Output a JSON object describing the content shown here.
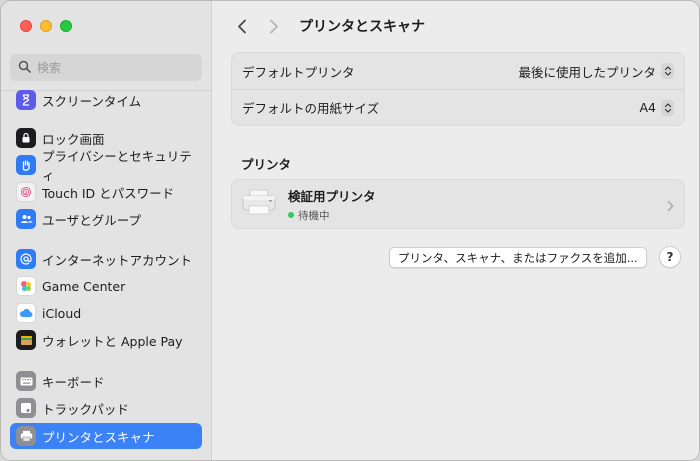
{
  "sidebar": {
    "search_placeholder": "検索",
    "items": [
      {
        "label": "スクリーンタイム",
        "icon": "hourglass-icon",
        "color": "#5e5ce6"
      },
      {
        "label": "ロック画面",
        "icon": "lock-screen-icon",
        "color": "#1c1c1e"
      },
      {
        "label": "プライバシーとセキュリティ",
        "icon": "hand-icon",
        "color": "#2f7bf5"
      },
      {
        "label": "Touch ID とパスワード",
        "icon": "fingerprint-icon",
        "color": "#f2f2f2"
      },
      {
        "label": "ユーザとグループ",
        "icon": "users-icon",
        "color": "#2f7bf5"
      },
      {
        "label": "インターネットアカウント",
        "icon": "at-icon",
        "color": "#2f7bf5"
      },
      {
        "label": "Game Center",
        "icon": "game-center-icon",
        "color": "#ffffff"
      },
      {
        "label": "iCloud",
        "icon": "icloud-icon",
        "color": "#ffffff"
      },
      {
        "label": "ウォレットと Apple Pay",
        "icon": "wallet-icon",
        "color": "#1c1c1e"
      },
      {
        "label": "キーボード",
        "icon": "keyboard-icon",
        "color": "#8e8e93"
      },
      {
        "label": "トラックパッド",
        "icon": "trackpad-icon",
        "color": "#8e8e93"
      },
      {
        "label": "プリンタとスキャナ",
        "icon": "printer-icon",
        "color": "#8e8e93",
        "selected": true
      }
    ]
  },
  "header": {
    "title": "プリンタとスキャナ"
  },
  "defaults": {
    "default_printer_label": "デフォルトプリンタ",
    "default_printer_value": "最後に使用したプリンタ",
    "paper_size_label": "デフォルトの用紙サイズ",
    "paper_size_value": "A4"
  },
  "printers": {
    "section_title": "プリンタ",
    "items": [
      {
        "name": "検証用プリンタ",
        "status": "待機中",
        "status_color": "#34c759"
      }
    ]
  },
  "actions": {
    "add_label": "プリンタ、スキャナ、またはファクスを追加...",
    "help_label": "?"
  },
  "colors": {
    "accent": "#3b82f6"
  }
}
